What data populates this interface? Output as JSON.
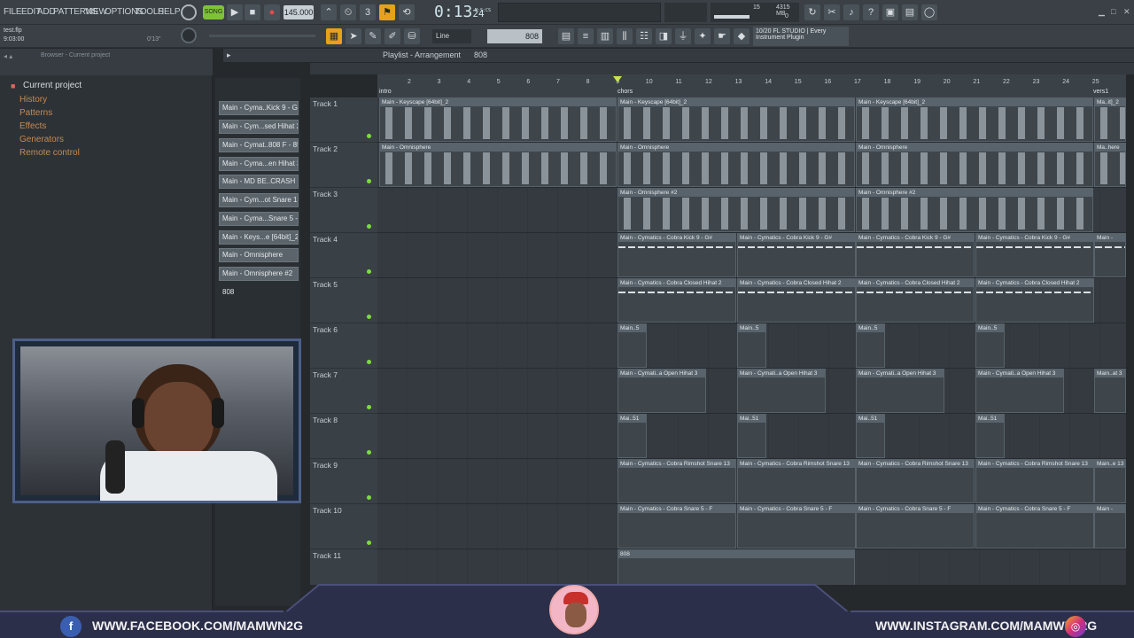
{
  "menu": [
    "FILE",
    "EDIT",
    "ADD",
    "PATTERNS",
    "VIEW",
    "OPTIONS",
    "TOOLS",
    "HELP"
  ],
  "transport": {
    "mode": "SONG",
    "tempo": "145.000",
    "time": "0:13",
    "time_frac": "24",
    "time_unit": "M:S:CS"
  },
  "project": {
    "file": "test.flp",
    "length": "9:03:00",
    "hint": "0'13\""
  },
  "cpu": {
    "num": "15",
    "mem": "4315 MB",
    "voices": "0"
  },
  "hint_bar": {
    "line1": "10/20 FL STUDIO | Every",
    "line2": "Instrument Plugin"
  },
  "snap": {
    "mode": "Line",
    "pattern": "808"
  },
  "browser": {
    "header": "Browser - Current project",
    "root": "Current project",
    "items": [
      "History",
      "Patterns",
      "Effects",
      "Generators",
      "Remote control"
    ]
  },
  "channels": [
    "Main - Cyma..Kick 9 - G#",
    "Main - Cym...sed Hihat 2",
    "Main - Cymat..808 F - 85",
    "Main - Cyma...en Hihat 3",
    "Main - MD BE..CRASH (5)",
    "Main - Cym...ot Snare 13",
    "Main - Cyma...Snare 5 - F",
    "Main - Keys...e [64bit]_2",
    "Main - Omnisphere",
    "Main - Omnisphere #2",
    "808"
  ],
  "playlist": {
    "title": "Playlist - Arrangement",
    "pattern": "808",
    "markers": {
      "intro": "intro",
      "chorus": "chors",
      "verse": "vers1"
    }
  },
  "ruler": [
    "2",
    "3",
    "4",
    "5",
    "6",
    "7",
    "8",
    "9",
    "10",
    "11",
    "12",
    "13",
    "14",
    "15",
    "16",
    "17",
    "18",
    "19",
    "20",
    "21",
    "22",
    "23",
    "24",
    "25"
  ],
  "tracks": [
    "Track 1",
    "Track 2",
    "Track 3",
    "Track 4",
    "Track 5",
    "Track 6",
    "Track 7",
    "Track 8",
    "Track 9",
    "Track 10",
    "Track 11"
  ],
  "clips": {
    "t1": "Main - Keyscape [64bit]_2",
    "t1b": "Main - Keyscape [64bit]_2",
    "t1c": "Main - Keyscape [64bit]_2",
    "t1d": "Ma..it]_2",
    "t2": "Main - Omnisphere",
    "t2b": "Main - Omnisphere",
    "t2c": "Main - Omnisphere",
    "t2d": "Ma..here",
    "t3": "Main - Omnisphere #2",
    "t3b": "Main - Omnisphere #2",
    "t4": "Main - Cymatics - Cobra Kick 9 - G#",
    "t4e": "Main -",
    "t5": "Main - Cymatics - Cobra Closed Hihat 2",
    "t6": "Main..5",
    "t7": "Main - Cymati..a Open Hihat 3",
    "t7e": "Main..at 3",
    "t8": "Mai..51",
    "t9": "Main - Cymatics - Cobra Rimshot Snare 13",
    "t9e": "Main..e 13",
    "t10": "Main - Cymatics - Cobra Snare 5 - F",
    "t10e": "Main -",
    "t11": "808"
  },
  "social": {
    "facebook": "WWW.FACEBOOK.COM/MAMWN2G",
    "instagram": "WWW.INSTAGRAM.COM/MAMWN_2G"
  }
}
